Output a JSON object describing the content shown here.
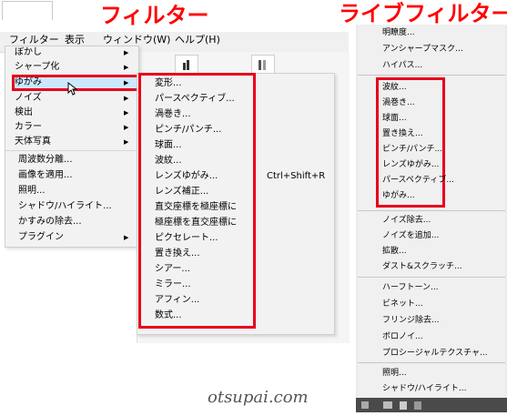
{
  "titles": {
    "filter": "フィルター",
    "live_filter": "ライブフィルター"
  },
  "menubar": [
    "フィルター",
    "表示",
    "ウィンドウ(W)",
    "ヘルプ(H)"
  ],
  "filter_menu": [
    {
      "label": "ぼかし",
      "has_sub": true
    },
    {
      "label": "シャープ化",
      "has_sub": true
    },
    {
      "label": "ゆがみ",
      "has_sub": true
    },
    {
      "label": "ノイズ",
      "has_sub": true
    },
    {
      "label": "検出",
      "has_sub": true
    },
    {
      "label": "カラー",
      "has_sub": true
    },
    {
      "label": "天体写真",
      "has_sub": true
    },
    {
      "label": "周波数分離...",
      "has_sub": false
    },
    {
      "label": "画像を適用...",
      "has_sub": false
    },
    {
      "label": "照明...",
      "has_sub": false
    },
    {
      "label": "シャドウ/ハイライト...",
      "has_sub": false
    },
    {
      "label": "かすみの除去...",
      "has_sub": false
    },
    {
      "label": "プラグイン",
      "has_sub": true
    }
  ],
  "distort_submenu": [
    "変形...",
    "パースペクティブ...",
    "渦巻き...",
    "ピンチ/パンチ...",
    "球面...",
    "波紋...",
    "レンズゆがみ...",
    "レンズ補正...",
    "直交座標を極座標に",
    "極座標を直交座標に",
    "ピクセレート...",
    "置き換え...",
    "シアー...",
    "ミラー...",
    "アフィン...",
    "数式..."
  ],
  "shortcut": "Ctrl+Shift+R",
  "live_filters": {
    "top": [
      "明瞭度...",
      "アンシャープマスク...",
      "ハイパス..."
    ],
    "distort": [
      "波紋...",
      "渦巻き...",
      "球面...",
      "置き換え...",
      "ピンチ/パンチ...",
      "レンズゆがみ...",
      "パースペクティブ...",
      "ゆがみ..."
    ],
    "noise": [
      "ノイズ除去...",
      "ノイズを追加...",
      "拡散...",
      "ダスト&スクラッチ..."
    ],
    "other": [
      "ハーフトーン...",
      "ビネット...",
      "フリンジ除去...",
      "ボロノイ...",
      "プロシージャルテクスチャ..."
    ],
    "bottom": [
      "照明...",
      "シャドウ/ハイライト..."
    ]
  },
  "watermark": "otsupai.com",
  "colors": {
    "title_red": "#ff0000",
    "box_red": "#e8001c",
    "highlight": "#cce8ff"
  },
  "icons": [
    "submenu-arrow-icon",
    "mouse-cursor-icon",
    "toolbar-chart-icon",
    "toolbar-align-icon",
    "panel-folder-icon",
    "panel-trash-icon"
  ]
}
